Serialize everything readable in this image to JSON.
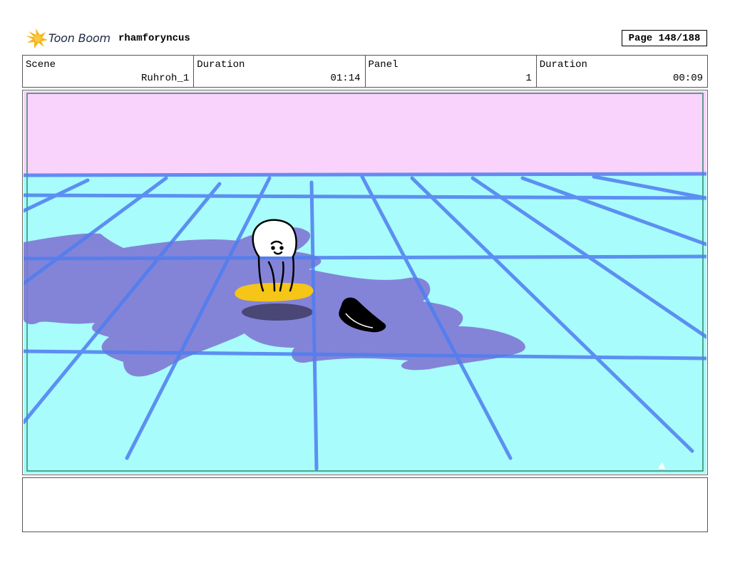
{
  "header": {
    "logo_text": "Toon Boom",
    "project_name": "rhamforyncus",
    "page_indicator": "Page 148/188"
  },
  "info": {
    "scene_label": "Scene",
    "scene_value": "Ruhroh_1",
    "duration_label": "Duration",
    "duration_value": "01:14",
    "panel_label": "Panel",
    "panel_value": "1",
    "panel_duration_label": "Duration",
    "panel_duration_value": "00:09"
  },
  "panel": {
    "sky_color": "#f9d3fb",
    "floor_color": "#a8fcfc",
    "grid_color": "#4f7df0",
    "shadow_color": "#7e77d4",
    "float_color": "#f5c518"
  },
  "notes": {
    "text": ""
  }
}
